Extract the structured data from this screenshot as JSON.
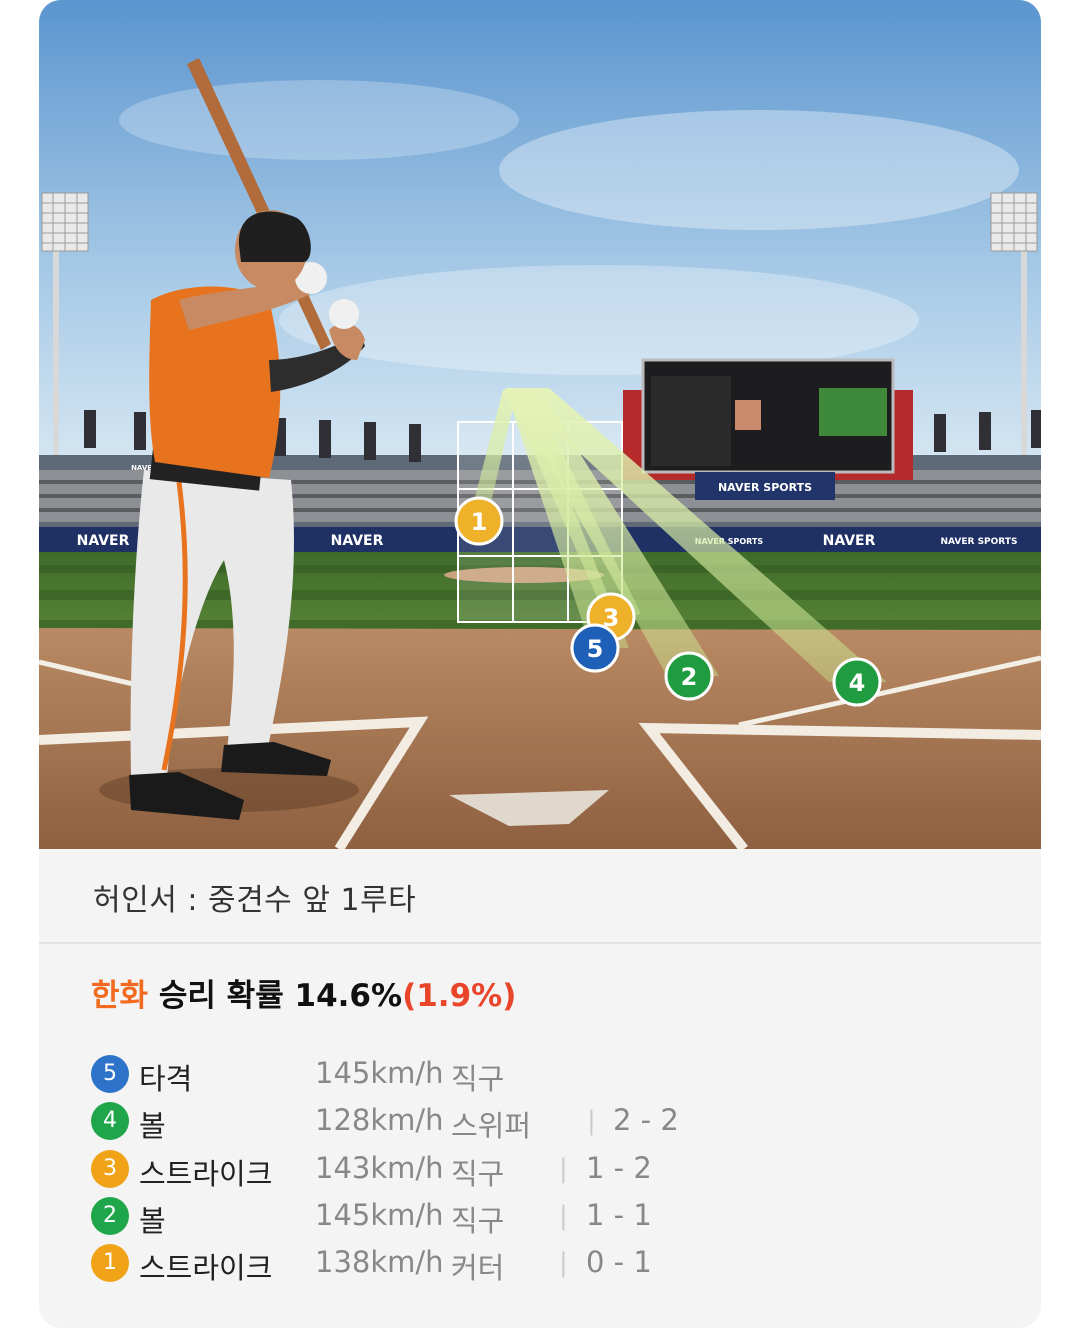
{
  "colors": {
    "team": "#f26a1f",
    "delta": "#e8452b",
    "hit": "#2d73c9",
    "ball": "#1fa64a",
    "strike": "#f0a317"
  },
  "scene": {
    "signboards": [
      "NAVER",
      "NAVER",
      "NAVER",
      "NAVER SPORTS",
      "NAVER SPORTS",
      "NAVER SPORTS"
    ],
    "scoreboard_brand": "NAVER SPORTS",
    "markers": [
      "1",
      "3",
      "5",
      "2",
      "4"
    ]
  },
  "play_result": "허인서 : 중견수 앞 1루타",
  "win_probability": {
    "team": "한화",
    "label": "승리 확률",
    "value": "14.6%",
    "delta": "(1.9%)"
  },
  "pitches": [
    {
      "num": "5",
      "kind": "hit",
      "result": "타격",
      "speed": "145km/h",
      "type": "직구",
      "count": ""
    },
    {
      "num": "4",
      "kind": "ball",
      "result": "볼",
      "speed": "128km/h",
      "type": "스위퍼",
      "count": "2 - 2"
    },
    {
      "num": "3",
      "kind": "strike",
      "result": "스트라이크",
      "speed": "143km/h",
      "type": "직구",
      "count": "1 - 2"
    },
    {
      "num": "2",
      "kind": "ball",
      "result": "볼",
      "speed": "145km/h",
      "type": "직구",
      "count": "1 - 1"
    },
    {
      "num": "1",
      "kind": "strike",
      "result": "스트라이크",
      "speed": "138km/h",
      "type": "커터",
      "count": "0 - 1"
    }
  ]
}
